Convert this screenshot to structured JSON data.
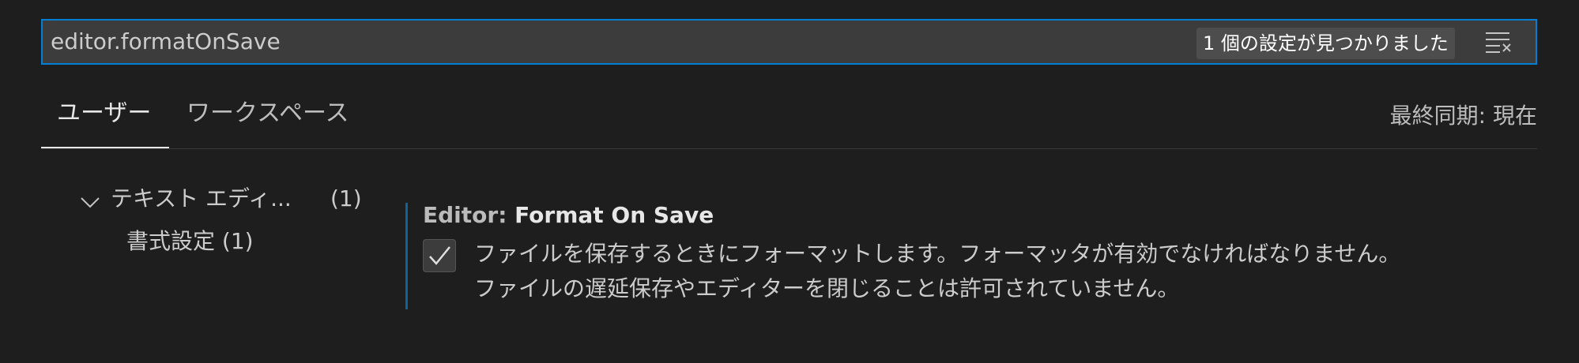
{
  "search": {
    "value": "editor.formatOnSave",
    "result_count_label": "1 個の設定が見つかりました",
    "clear_icon": "clear-filter-icon"
  },
  "tabs": [
    {
      "label": "ユーザー",
      "active": true
    },
    {
      "label": "ワークスペース",
      "active": false
    }
  ],
  "sync_status": "最終同期: 現在",
  "toc": {
    "group": {
      "label": "テキスト エディ...",
      "count": "(1)",
      "icon": "chevron-down-icon"
    },
    "item": {
      "label": "書式設定 (1)"
    }
  },
  "setting": {
    "category": "Editor: ",
    "name": "Format On Save",
    "checked": true,
    "description_line1": "ファイルを保存するときにフォーマットします。フォーマッタが有効でなければなりません。",
    "description_line2": "ファイルの遅延保存やエディターを閉じることは許可されていません。"
  },
  "colors": {
    "background": "#1e1e1e",
    "focus_border": "#007fd4",
    "modified_indicator": "#0e639c"
  }
}
